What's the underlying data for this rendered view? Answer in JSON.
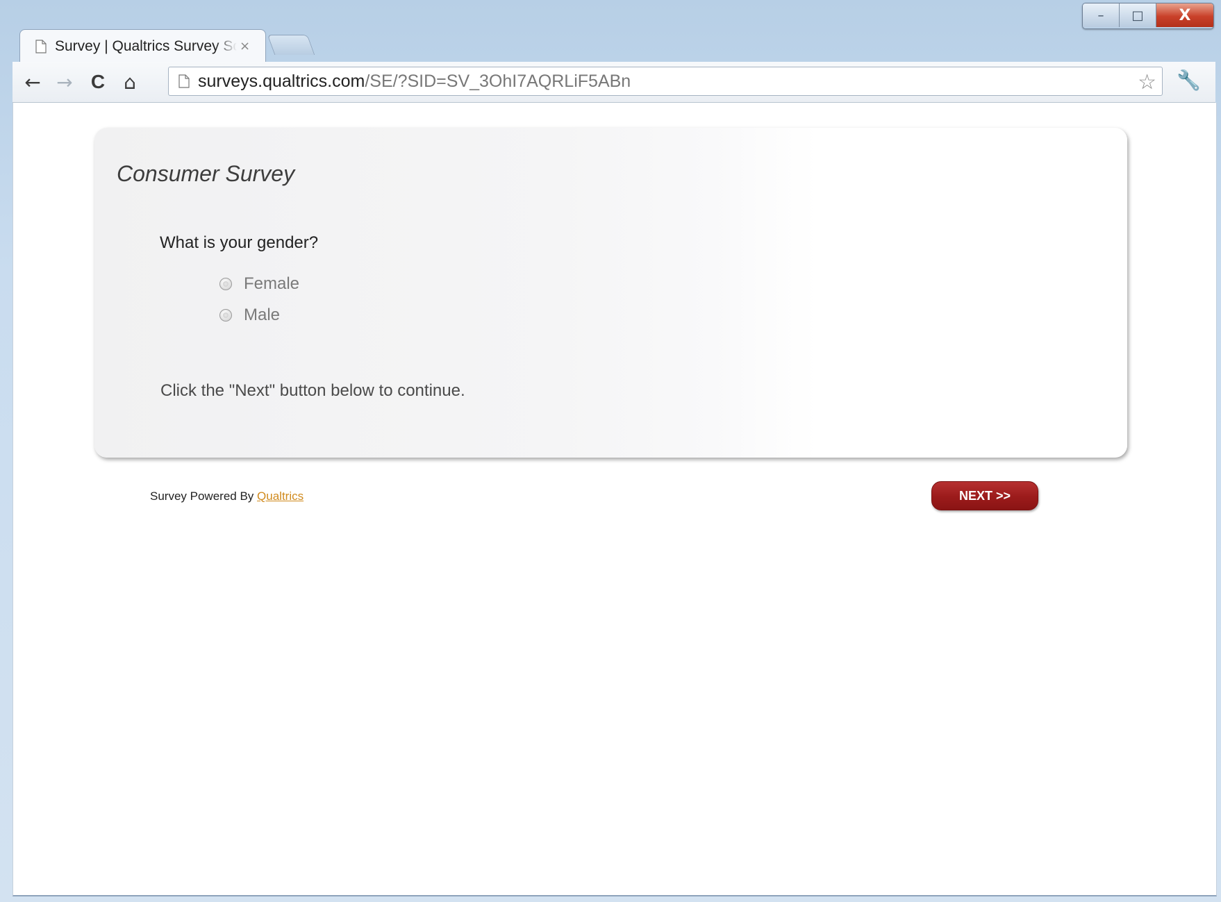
{
  "browser": {
    "tab_title": "Survey | Qualtrics Survey Software",
    "tab_close": "×",
    "url_host": "surveys.qualtrics.com",
    "url_path": "/SE/?SID=SV_3OhI7AQRLiF5ABn",
    "controls": {
      "minimize": "–",
      "maximize": "□",
      "close": "X"
    },
    "icons": {
      "back": "←",
      "forward": "→",
      "reload": "C",
      "home": "⌂",
      "star": "☆",
      "wrench": "🔧"
    }
  },
  "survey": {
    "title": "Consumer Survey",
    "question": "What is your gender?",
    "choices": [
      "Female",
      "Male"
    ],
    "instruction": "Click the \"Next\" button below to continue."
  },
  "footer": {
    "powered_by": "Survey Powered By",
    "brand_link": "Qualtrics",
    "next_button": "NEXT >>"
  },
  "colors": {
    "next_button": "#9b1b1b",
    "brand_link": "#d08a1d"
  }
}
